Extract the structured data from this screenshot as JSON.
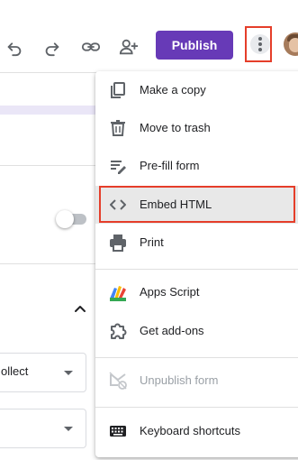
{
  "colors": {
    "accent": "#673ab7",
    "highlight_border": "#e53e2a",
    "icon": "#5f6368",
    "disabled_text": "#9aa0a6"
  },
  "toolbar": {
    "undo_icon": "undo-icon",
    "redo_icon": "redo-icon",
    "link_icon": "link-icon",
    "add_collaborator_icon": "person-add-icon",
    "publish_label": "Publish",
    "more_icon": "more-vert-icon"
  },
  "background": {
    "select_1_text": "ollect"
  },
  "menu": {
    "items": [
      {
        "label": "Make a copy",
        "icon": "copy-icon"
      },
      {
        "label": "Move to trash",
        "icon": "trash-icon"
      },
      {
        "label": "Pre-fill form",
        "icon": "prefill-icon"
      },
      {
        "label": "Embed HTML",
        "icon": "code-icon"
      },
      {
        "label": "Print",
        "icon": "print-icon"
      },
      {
        "label": "Apps Script",
        "icon": "apps-script-icon"
      },
      {
        "label": "Get add-ons",
        "icon": "puzzle-icon"
      },
      {
        "label": "Unpublish form",
        "icon": "unpublish-icon"
      },
      {
        "label": "Keyboard shortcuts",
        "icon": "keyboard-icon"
      }
    ]
  }
}
